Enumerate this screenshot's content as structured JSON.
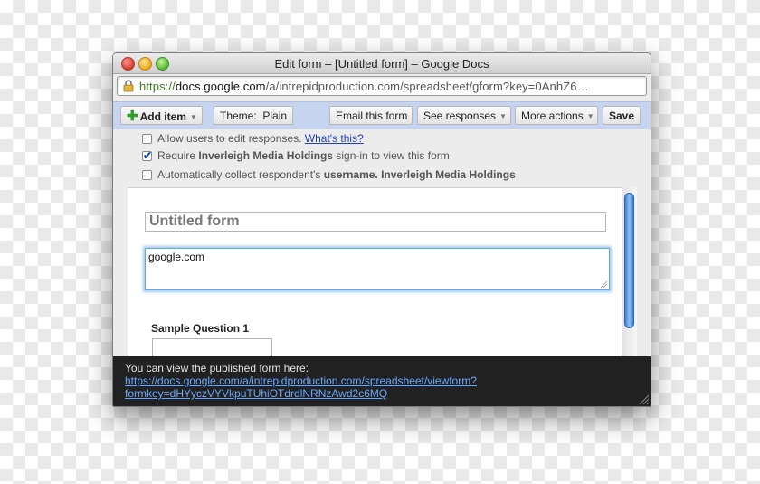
{
  "window": {
    "title": "Edit form – [Untitled form] – Google Docs"
  },
  "url_bar": {
    "protocol": "https://",
    "host": "docs.google.com",
    "path": "/a/intrepidproduction.com/spreadsheet/gform?key=0AnhZ6…"
  },
  "toolbar": {
    "add_item": "Add item",
    "theme": "Theme:  Plain",
    "email_form": "Email this form",
    "see_responses": "See responses",
    "more_actions": "More actions",
    "save": "Save"
  },
  "options": [
    {
      "checked": false,
      "text": "Allow users to edit responses.",
      "link": "What's this?"
    },
    {
      "checked": true,
      "pre": "Require ",
      "bold": "Inverleigh Media Holdings",
      "post": " sign-in to view this form."
    },
    {
      "checked": false,
      "pre": "Automatically collect respondent's ",
      "bold": "username. Inverleigh Media Holdings",
      "post": ""
    }
  ],
  "form": {
    "title": "Untitled form",
    "description": "google.com",
    "question_label": "Sample Question 1",
    "question_value": ""
  },
  "footer": {
    "message": "You can view the published form here:",
    "link_line1": "https://docs.google.com/a/intrepidproduction.com/spreadsheet/viewform?",
    "link_line2": "formkey=dHYyczVYVkpuTUhiOTdrdlNRNzAwd2c6MQ"
  },
  "colors": {
    "toolbar_bg": "#c6d4ef",
    "link": "#1e3fbf",
    "footer_bg": "#212121",
    "footer_link": "#6aa8ff",
    "focus_ring": "#6aa9e0"
  },
  "icons": [
    "close-icon",
    "minimize-icon",
    "zoom-icon",
    "lock-icon",
    "plus-icon",
    "chevron-down-icon",
    "check-icon"
  ]
}
